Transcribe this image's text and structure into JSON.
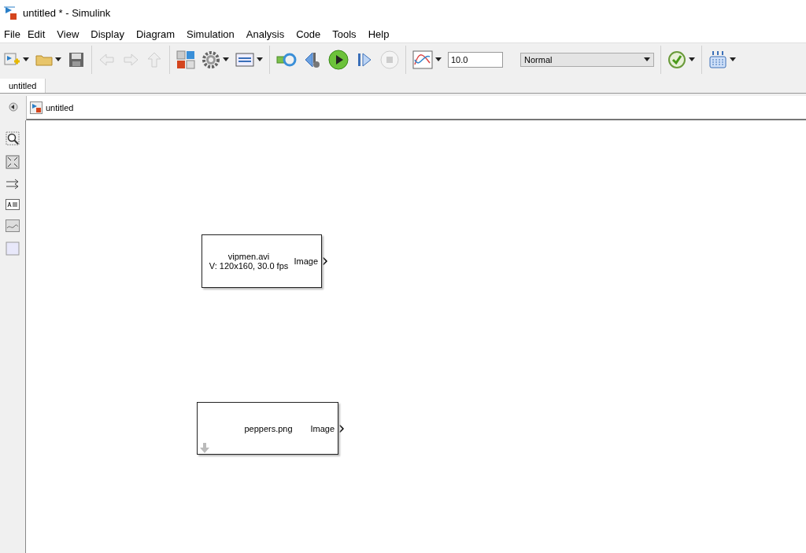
{
  "window": {
    "title": "untitled * - Simulink"
  },
  "menu": [
    "File",
    "Edit",
    "View",
    "Display",
    "Diagram",
    "Simulation",
    "Analysis",
    "Code",
    "Tools",
    "Help"
  ],
  "toolbar": {
    "stop_time": "10.0",
    "mode": "Normal"
  },
  "tabs": [
    {
      "label": "untitled",
      "selected": true
    }
  ],
  "breadcrumb": "untitled",
  "blocks": [
    {
      "kind": "video",
      "lines": [
        "vipmen.avi",
        "V: 120x160, 30.0 fps"
      ],
      "port": "Image"
    },
    {
      "kind": "image",
      "lines": [
        "peppers.png"
      ],
      "port": "Image"
    }
  ]
}
